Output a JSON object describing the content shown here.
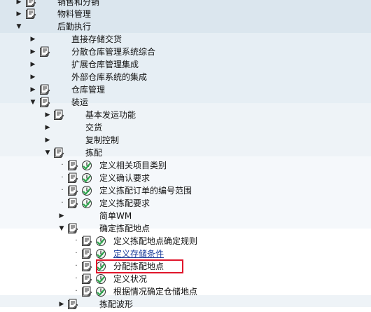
{
  "tree": [
    {
      "depth": 0,
      "expander": "collapsed",
      "icon": "doc",
      "label": "销售和分销"
    },
    {
      "depth": 0,
      "expander": "collapsed",
      "icon": "doc",
      "label": "物料管理"
    },
    {
      "depth": 0,
      "expander": "expanded",
      "icon": "none",
      "label": "后勤执行"
    },
    {
      "depth": 1,
      "expander": "collapsed",
      "icon": "none",
      "label": "直接存储交货"
    },
    {
      "depth": 1,
      "expander": "collapsed",
      "icon": "doc",
      "label": "分散仓库管理系统综合"
    },
    {
      "depth": 1,
      "expander": "collapsed",
      "icon": "none",
      "label": "扩展仓库管理集成"
    },
    {
      "depth": 1,
      "expander": "collapsed",
      "icon": "none",
      "label": "外部仓库系统的集成"
    },
    {
      "depth": 1,
      "expander": "collapsed",
      "icon": "doc",
      "label": "仓库管理"
    },
    {
      "depth": 1,
      "expander": "expanded",
      "icon": "doc",
      "label": "装运"
    },
    {
      "depth": 2,
      "expander": "collapsed",
      "icon": "doc",
      "label": "基本发运功能"
    },
    {
      "depth": 2,
      "expander": "collapsed",
      "icon": "none",
      "label": "交货"
    },
    {
      "depth": 2,
      "expander": "collapsed",
      "icon": "none",
      "label": "复制控制"
    },
    {
      "depth": 2,
      "expander": "expanded",
      "icon": "doc",
      "label": "拣配"
    },
    {
      "depth": 3,
      "expander": "leaf",
      "icon": "doc-clock",
      "label": "定义相关项目类别"
    },
    {
      "depth": 3,
      "expander": "leaf",
      "icon": "doc-clock",
      "label": "定义确认要求"
    },
    {
      "depth": 3,
      "expander": "leaf",
      "icon": "doc-clock",
      "label": "定义拣配订单的编号范围"
    },
    {
      "depth": 3,
      "expander": "leaf",
      "icon": "doc-clock",
      "label": "定义拣配要求"
    },
    {
      "depth": 3,
      "expander": "collapsed",
      "icon": "none",
      "label": "简单WM"
    },
    {
      "depth": 3,
      "expander": "expanded",
      "icon": "doc",
      "label": "确定拣配地点"
    },
    {
      "depth": 4,
      "expander": "leaf",
      "icon": "doc-clock",
      "label": "定义拣配地点确定规则"
    },
    {
      "depth": 4,
      "expander": "leaf",
      "icon": "doc-clock",
      "label": "定义存储条件",
      "link": true
    },
    {
      "depth": 4,
      "expander": "leaf",
      "icon": "doc-clock",
      "label": "分配拣配地点",
      "highlight": true
    },
    {
      "depth": 4,
      "expander": "leaf",
      "icon": "doc-clock",
      "label": "定义状况"
    },
    {
      "depth": 4,
      "expander": "leaf",
      "icon": "doc-clock",
      "label": "根据情况确定仓储地点"
    },
    {
      "depth": 3,
      "expander": "collapsed",
      "icon": "doc",
      "label": "拣配波形"
    }
  ],
  "colors": {
    "band_l0": "#dbe6ee",
    "band_l1": "#e6eef4",
    "band_l2": "#eef3f7",
    "band_l3": "#f5f8fb",
    "band_l4": "#ffffff",
    "band_last": "#eef3f7",
    "highlight_border": "#e0162b",
    "link": "#1a3c9a",
    "clock_green": "#2fa84f"
  }
}
